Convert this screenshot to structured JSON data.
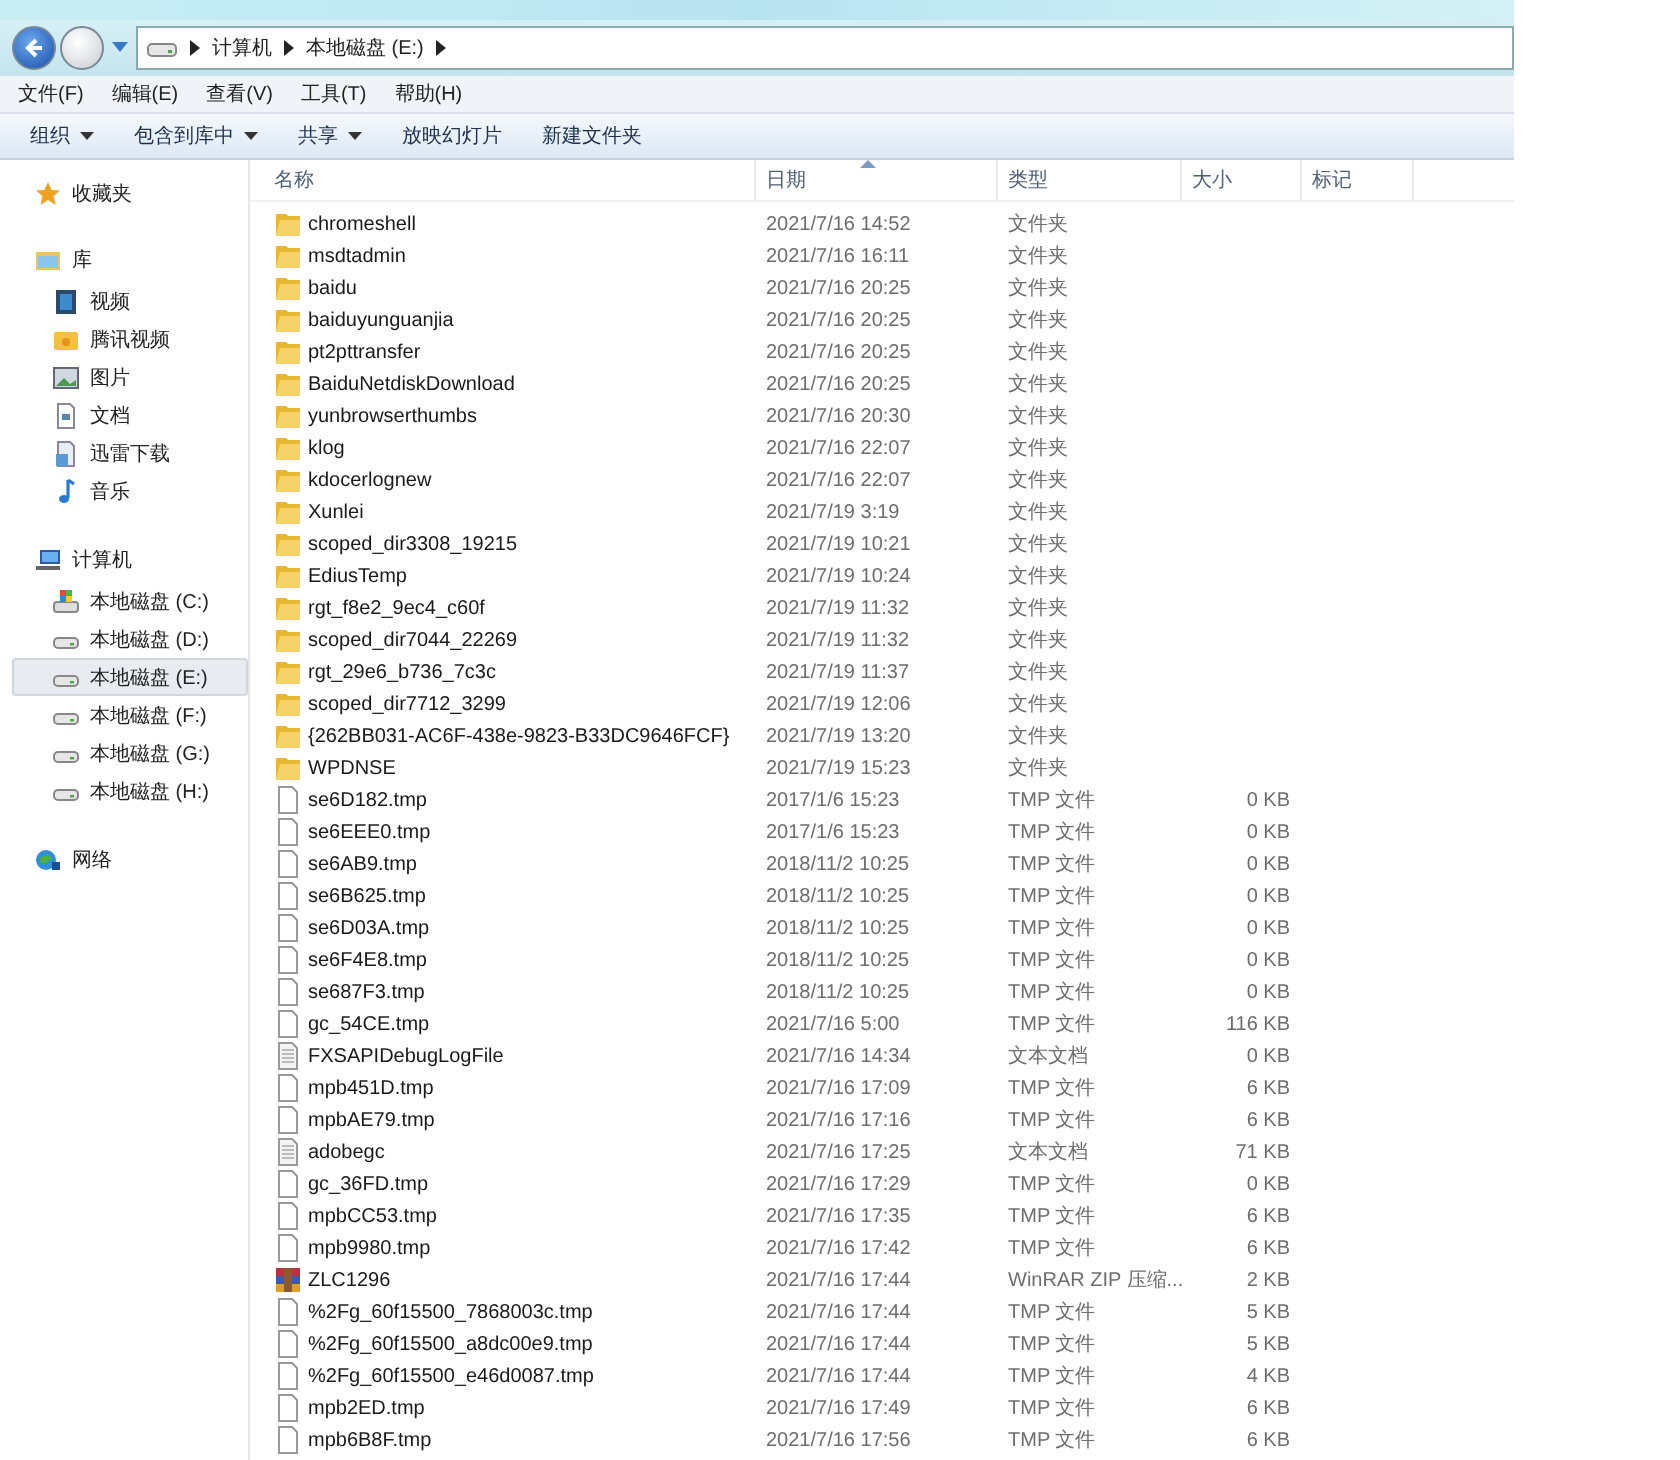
{
  "address_bar": {
    "crumbs": [
      "计算机",
      "本地磁盘 (E:)"
    ]
  },
  "menu": [
    "文件(F)",
    "编辑(E)",
    "查看(V)",
    "工具(T)",
    "帮助(H)"
  ],
  "toolbar": [
    {
      "label": "组织",
      "dropdown": true
    },
    {
      "label": "包含到库中",
      "dropdown": true
    },
    {
      "label": "共享",
      "dropdown": true
    },
    {
      "label": "放映幻灯片",
      "dropdown": false
    },
    {
      "label": "新建文件夹",
      "dropdown": false
    }
  ],
  "sidebar": [
    {
      "label": "收藏夹",
      "kind": "star"
    },
    {
      "label": "库",
      "kind": "library",
      "children": [
        {
          "label": "视频",
          "kind": "video",
          "selected": false
        },
        {
          "label": "腾讯视频",
          "kind": "folder",
          "selected": false
        },
        {
          "label": "图片",
          "kind": "picture",
          "selected": false
        },
        {
          "label": "文档",
          "kind": "document",
          "selected": false
        },
        {
          "label": "迅雷下载",
          "kind": "download",
          "selected": false
        },
        {
          "label": "音乐",
          "kind": "music",
          "selected": false
        }
      ]
    },
    {
      "label": "计算机",
      "kind": "computer",
      "children": [
        {
          "label": "本地磁盘 (C:)",
          "kind": "system-drive",
          "selected": false
        },
        {
          "label": "本地磁盘 (D:)",
          "kind": "drive",
          "selected": false
        },
        {
          "label": "本地磁盘 (E:)",
          "kind": "drive",
          "selected": true
        },
        {
          "label": "本地磁盘 (F:)",
          "kind": "drive",
          "selected": false
        },
        {
          "label": "本地磁盘 (G:)",
          "kind": "drive",
          "selected": false
        },
        {
          "label": "本地磁盘 (H:)",
          "kind": "drive",
          "selected": false
        }
      ]
    },
    {
      "label": "网络",
      "kind": "network"
    }
  ],
  "columns": [
    {
      "label": "名称",
      "sorted": false
    },
    {
      "label": "日期",
      "sorted": true
    },
    {
      "label": "类型",
      "sorted": false
    },
    {
      "label": "大小",
      "sorted": false
    },
    {
      "label": "标记",
      "sorted": false
    }
  ],
  "rows": [
    {
      "kind": "folder",
      "name": "chromeshell",
      "date": "2021/7/16 14:52",
      "type": "文件夹"
    },
    {
      "kind": "folder",
      "name": "msdtadmin",
      "date": "2021/7/16 16:11",
      "type": "文件夹"
    },
    {
      "kind": "folder",
      "name": "baidu",
      "date": "2021/7/16 20:25",
      "type": "文件夹"
    },
    {
      "kind": "folder",
      "name": "baiduyunguanjia",
      "date": "2021/7/16 20:25",
      "type": "文件夹"
    },
    {
      "kind": "folder",
      "name": "pt2pttransfer",
      "date": "2021/7/16 20:25",
      "type": "文件夹"
    },
    {
      "kind": "folder",
      "name": "BaiduNetdiskDownload",
      "date": "2021/7/16 20:25",
      "type": "文件夹"
    },
    {
      "kind": "folder",
      "name": "yunbrowserthumbs",
      "date": "2021/7/16 20:30",
      "type": "文件夹"
    },
    {
      "kind": "folder",
      "name": "klog",
      "date": "2021/7/16 22:07",
      "type": "文件夹"
    },
    {
      "kind": "folder",
      "name": "kdocerlognew",
      "date": "2021/7/16 22:07",
      "type": "文件夹"
    },
    {
      "kind": "folder",
      "name": "Xunlei",
      "date": "2021/7/19 3:19",
      "type": "文件夹"
    },
    {
      "kind": "folder",
      "name": "scoped_dir3308_19215",
      "date": "2021/7/19 10:21",
      "type": "文件夹"
    },
    {
      "kind": "folder",
      "name": "EdiusTemp",
      "date": "2021/7/19 10:24",
      "type": "文件夹"
    },
    {
      "kind": "folder",
      "name": "rgt_f8e2_9ec4_c60f",
      "date": "2021/7/19 11:32",
      "type": "文件夹"
    },
    {
      "kind": "folder",
      "name": "scoped_dir7044_22269",
      "date": "2021/7/19 11:32",
      "type": "文件夹"
    },
    {
      "kind": "folder",
      "name": "rgt_29e6_b736_7c3c",
      "date": "2021/7/19 11:37",
      "type": "文件夹"
    },
    {
      "kind": "folder",
      "name": "scoped_dir7712_3299",
      "date": "2021/7/19 12:06",
      "type": "文件夹"
    },
    {
      "kind": "folder",
      "name": "{262BB031-AC6F-438e-9823-B33DC9646FCF}",
      "date": "2021/7/19 13:20",
      "type": "文件夹"
    },
    {
      "kind": "folder",
      "name": "WPDNSE",
      "date": "2021/7/19 15:23",
      "type": "文件夹"
    },
    {
      "kind": "file",
      "name": "se6D182.tmp",
      "date": "2017/1/6 15:23",
      "type": "TMP 文件",
      "size": "0 KB"
    },
    {
      "kind": "file",
      "name": "se6EEE0.tmp",
      "date": "2017/1/6 15:23",
      "type": "TMP 文件",
      "size": "0 KB"
    },
    {
      "kind": "file",
      "name": "se6AB9.tmp",
      "date": "2018/11/2 10:25",
      "type": "TMP 文件",
      "size": "0 KB"
    },
    {
      "kind": "file",
      "name": "se6B625.tmp",
      "date": "2018/11/2 10:25",
      "type": "TMP 文件",
      "size": "0 KB"
    },
    {
      "kind": "file",
      "name": "se6D03A.tmp",
      "date": "2018/11/2 10:25",
      "type": "TMP 文件",
      "size": "0 KB"
    },
    {
      "kind": "file",
      "name": "se6F4E8.tmp",
      "date": "2018/11/2 10:25",
      "type": "TMP 文件",
      "size": "0 KB"
    },
    {
      "kind": "file",
      "name": "se687F3.tmp",
      "date": "2018/11/2 10:25",
      "type": "TMP 文件",
      "size": "0 KB"
    },
    {
      "kind": "file",
      "name": "gc_54CE.tmp",
      "date": "2021/7/16 5:00",
      "type": "TMP 文件",
      "size": "116 KB"
    },
    {
      "kind": "text",
      "name": "FXSAPIDebugLogFile",
      "date": "2021/7/16 14:34",
      "type": "文本文档",
      "size": "0 KB"
    },
    {
      "kind": "file",
      "name": "mpb451D.tmp",
      "date": "2021/7/16 17:09",
      "type": "TMP 文件",
      "size": "6 KB"
    },
    {
      "kind": "file",
      "name": "mpbAE79.tmp",
      "date": "2021/7/16 17:16",
      "type": "TMP 文件",
      "size": "6 KB"
    },
    {
      "kind": "text",
      "name": "adobegc",
      "date": "2021/7/16 17:25",
      "type": "文本文档",
      "size": "71 KB"
    },
    {
      "kind": "file",
      "name": "gc_36FD.tmp",
      "date": "2021/7/16 17:29",
      "type": "TMP 文件",
      "size": "0 KB"
    },
    {
      "kind": "file",
      "name": "mpbCC53.tmp",
      "date": "2021/7/16 17:35",
      "type": "TMP 文件",
      "size": "6 KB"
    },
    {
      "kind": "file",
      "name": "mpb9980.tmp",
      "date": "2021/7/16 17:42",
      "type": "TMP 文件",
      "size": "6 KB"
    },
    {
      "kind": "archive",
      "name": "ZLC1296",
      "date": "2021/7/16 17:44",
      "type": "WinRAR ZIP 压缩...",
      "size": "2 KB"
    },
    {
      "kind": "file",
      "name": "%2Fg_60f15500_7868003c.tmp",
      "date": "2021/7/16 17:44",
      "type": "TMP 文件",
      "size": "5 KB"
    },
    {
      "kind": "file",
      "name": "%2Fg_60f15500_a8dc00e9.tmp",
      "date": "2021/7/16 17:44",
      "type": "TMP 文件",
      "size": "5 KB"
    },
    {
      "kind": "file",
      "name": "%2Fg_60f15500_e46d0087.tmp",
      "date": "2021/7/16 17:44",
      "type": "TMP 文件",
      "size": "4 KB"
    },
    {
      "kind": "file",
      "name": "mpb2ED.tmp",
      "date": "2021/7/16 17:49",
      "type": "TMP 文件",
      "size": "6 KB"
    },
    {
      "kind": "file",
      "name": "mpb6B8F.tmp",
      "date": "2021/7/16 17:56",
      "type": "TMP 文件",
      "size": "6 KB"
    }
  ]
}
